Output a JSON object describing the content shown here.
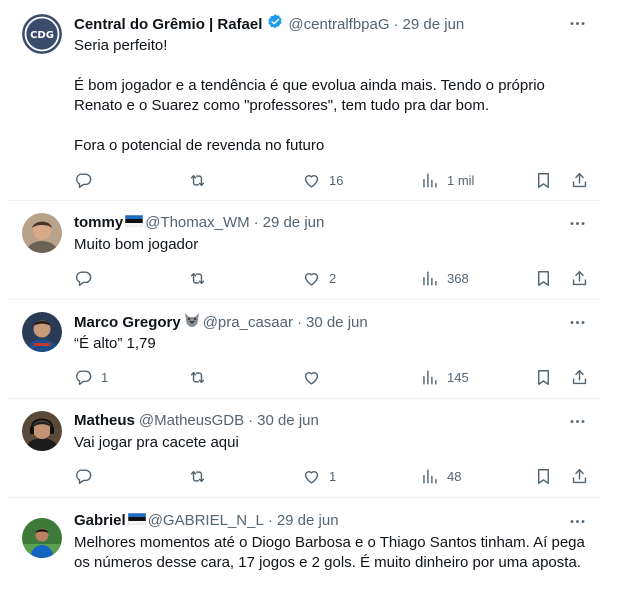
{
  "tweets": [
    {
      "name": "Central do Grêmio | Rafael",
      "handle": "@centralfbpaG",
      "date": "29 de jun",
      "verified": true,
      "body": [
        "Seria perfeito!",
        "É bom jogador e a tendência é que evolua ainda mais. Tendo o próprio Renato e o Suarez como \"professores\", tem tudo pra dar bom.",
        "Fora o potencial de revenda no futuro"
      ],
      "replies": "",
      "retweets": "",
      "likes": "16",
      "views": "1 mil",
      "avatar_text": "CDG"
    },
    {
      "name": "tommy",
      "handle": "@Thomax_WM",
      "date": "29 de jun",
      "body": [
        "Muito bom jogador"
      ],
      "replies": "",
      "retweets": "",
      "likes": "2",
      "views": "368"
    },
    {
      "name": "Marco Gregory",
      "handle": "@pra_casaar",
      "date": "30 de jun",
      "body": [
        "“É alto” 1,79"
      ],
      "replies": "1",
      "retweets": "",
      "likes": "",
      "views": "145"
    },
    {
      "name": "Matheus",
      "handle": "@MatheusGDB",
      "date": "30 de jun",
      "body": [
        "Vai jogar pra cacete aqui"
      ],
      "replies": "",
      "retweets": "",
      "likes": "1",
      "views": "48"
    },
    {
      "name": "Gabriel",
      "handle": "@GABRIEL_N_L",
      "date": "29 de jun",
      "body": [
        "Melhores momentos até o Diogo Barbosa e o Thiago Santos tinham. Aí pega os números desse cara, 17 jogos e 2 gols. É muito dinheiro por uma aposta."
      ]
    }
  ],
  "colors": {
    "text": "#0f1419",
    "muted": "#536471",
    "verified": "#1d9bf0",
    "divider": "#eff3f4"
  },
  "icons": [
    "reply-icon",
    "retweet-icon",
    "like-icon",
    "views-icon",
    "bookmark-icon",
    "share-icon",
    "more-icon",
    "verified-badge-icon"
  ]
}
